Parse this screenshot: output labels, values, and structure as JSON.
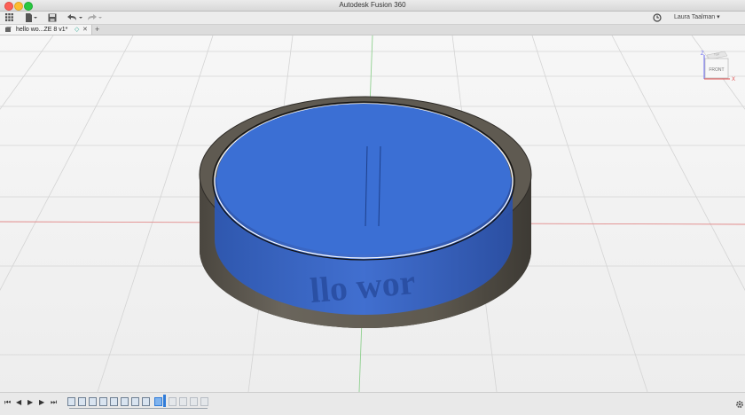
{
  "window": {
    "title": "Autodesk Fusion 360"
  },
  "toolbar": {
    "user_name": "Laura Taalman",
    "user_caret": "▾",
    "data_panel_icon": "grid-icon",
    "file_icon": "file-icon",
    "save_icon": "save-icon",
    "undo_icon": "undo-icon",
    "redo_icon": "redo-icon",
    "job_status_icon": "clock-icon"
  },
  "tabs": [
    {
      "label": "hello wo...ZE 8 v1*",
      "active": true
    }
  ],
  "tab_controls": {
    "close": "✕",
    "add": "+"
  },
  "viewcube": {
    "face_label": "FRONT",
    "axis_z": "Z",
    "axis_x": "X",
    "top_label": "TOP"
  },
  "model": {
    "body_color": "#3b6fd4",
    "shell_color": "#5b564e",
    "engraved_text": "llo wor"
  },
  "timeline": {
    "playback": [
      "⏮",
      "◀",
      "▶",
      "▶",
      "⏭"
    ],
    "settings_icon": "gear-icon",
    "feature_count": 12
  }
}
